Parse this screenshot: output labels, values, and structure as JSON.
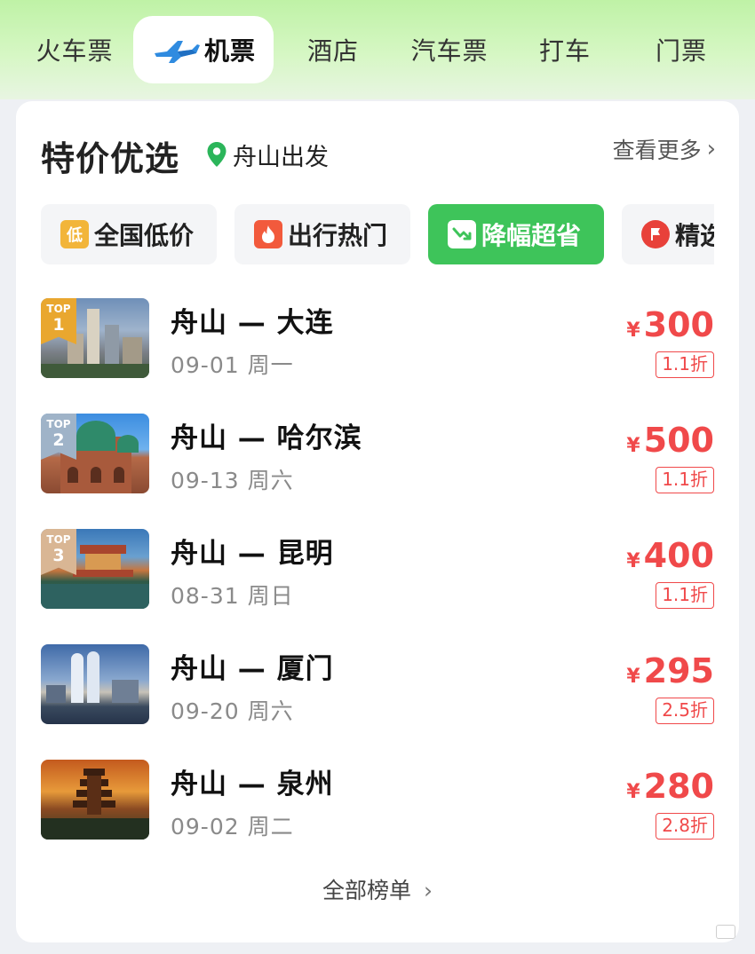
{
  "tabs": [
    {
      "label": "火车票"
    },
    {
      "label": "机票"
    },
    {
      "label": "酒店"
    },
    {
      "label": "汽车票"
    },
    {
      "label": "打车"
    },
    {
      "label": "门票"
    }
  ],
  "active_tab": "机票",
  "section": {
    "title": "特价优选",
    "location": "舟山出发",
    "more_label": "查看更多"
  },
  "chips": [
    {
      "label": "全国低价",
      "icon": "low-price-icon",
      "icon_text": "低"
    },
    {
      "label": "出行热门",
      "icon": "flame-icon"
    },
    {
      "label": "降幅超省",
      "icon": "price-drop-icon"
    },
    {
      "label": "精选",
      "icon": "flag-icon"
    }
  ],
  "active_chip": "降幅超省",
  "flights": [
    {
      "route": "舟山 — 大连",
      "date": "09-01 周一",
      "currency": "¥",
      "price": "300",
      "discount": "1.1折",
      "rank_label": "TOP",
      "rank": "1"
    },
    {
      "route": "舟山 — 哈尔滨",
      "date": "09-13 周六",
      "currency": "¥",
      "price": "500",
      "discount": "1.1折",
      "rank_label": "TOP",
      "rank": "2"
    },
    {
      "route": "舟山 — 昆明",
      "date": "08-31 周日",
      "currency": "¥",
      "price": "400",
      "discount": "1.1折",
      "rank_label": "TOP",
      "rank": "3"
    },
    {
      "route": "舟山 — 厦门",
      "date": "09-20 周六",
      "currency": "¥",
      "price": "295",
      "discount": "2.5折"
    },
    {
      "route": "舟山 — 泉州",
      "date": "09-02 周二",
      "currency": "¥",
      "price": "280",
      "discount": "2.8折"
    }
  ],
  "footer": {
    "all_list_label": "全部榜单"
  },
  "colors": {
    "accent_green": "#3ec45a",
    "price_red": "#f0494a",
    "location_pin": "#2bb55a"
  }
}
